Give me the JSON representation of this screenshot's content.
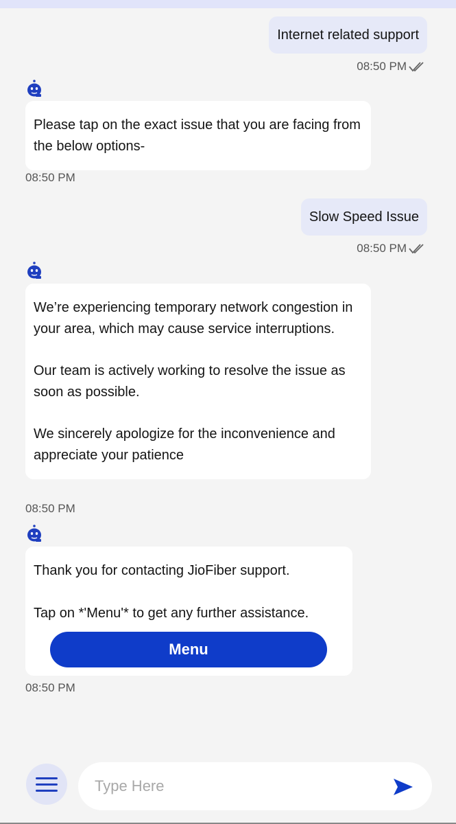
{
  "messages": [
    {
      "from": "user",
      "text": "Internet related support",
      "time": "08:50 PM"
    },
    {
      "from": "bot",
      "paragraphs": [
        "Please tap on the exact issue that you are facing from the below options-"
      ],
      "time": "08:50 PM"
    },
    {
      "from": "user",
      "text": "Slow Speed Issue",
      "time": "08:50 PM"
    },
    {
      "from": "bot",
      "paragraphs": [
        "We’re experiencing temporary network congestion in your area, which may cause service interruptions.",
        "Our team is actively working to resolve the issue as soon as possible.",
        "We sincerely apologize for the inconvenience and appreciate your patience"
      ],
      "time": "08:50 PM"
    },
    {
      "from": "bot",
      "paragraphs": [
        "Thank you for contacting JioFiber support.",
        "Tap on *'Menu'* to get any further assistance."
      ],
      "button": "Menu",
      "time": "08:50 PM"
    }
  ],
  "composer": {
    "placeholder": "Type Here",
    "menu_icon": "hamburger-menu-icon",
    "send_icon": "send-icon"
  },
  "colors": {
    "accent": "#0f3cc9",
    "user_bubble": "#e6e9f8",
    "bot_bubble": "#ffffff",
    "background": "#f4f4f4"
  }
}
